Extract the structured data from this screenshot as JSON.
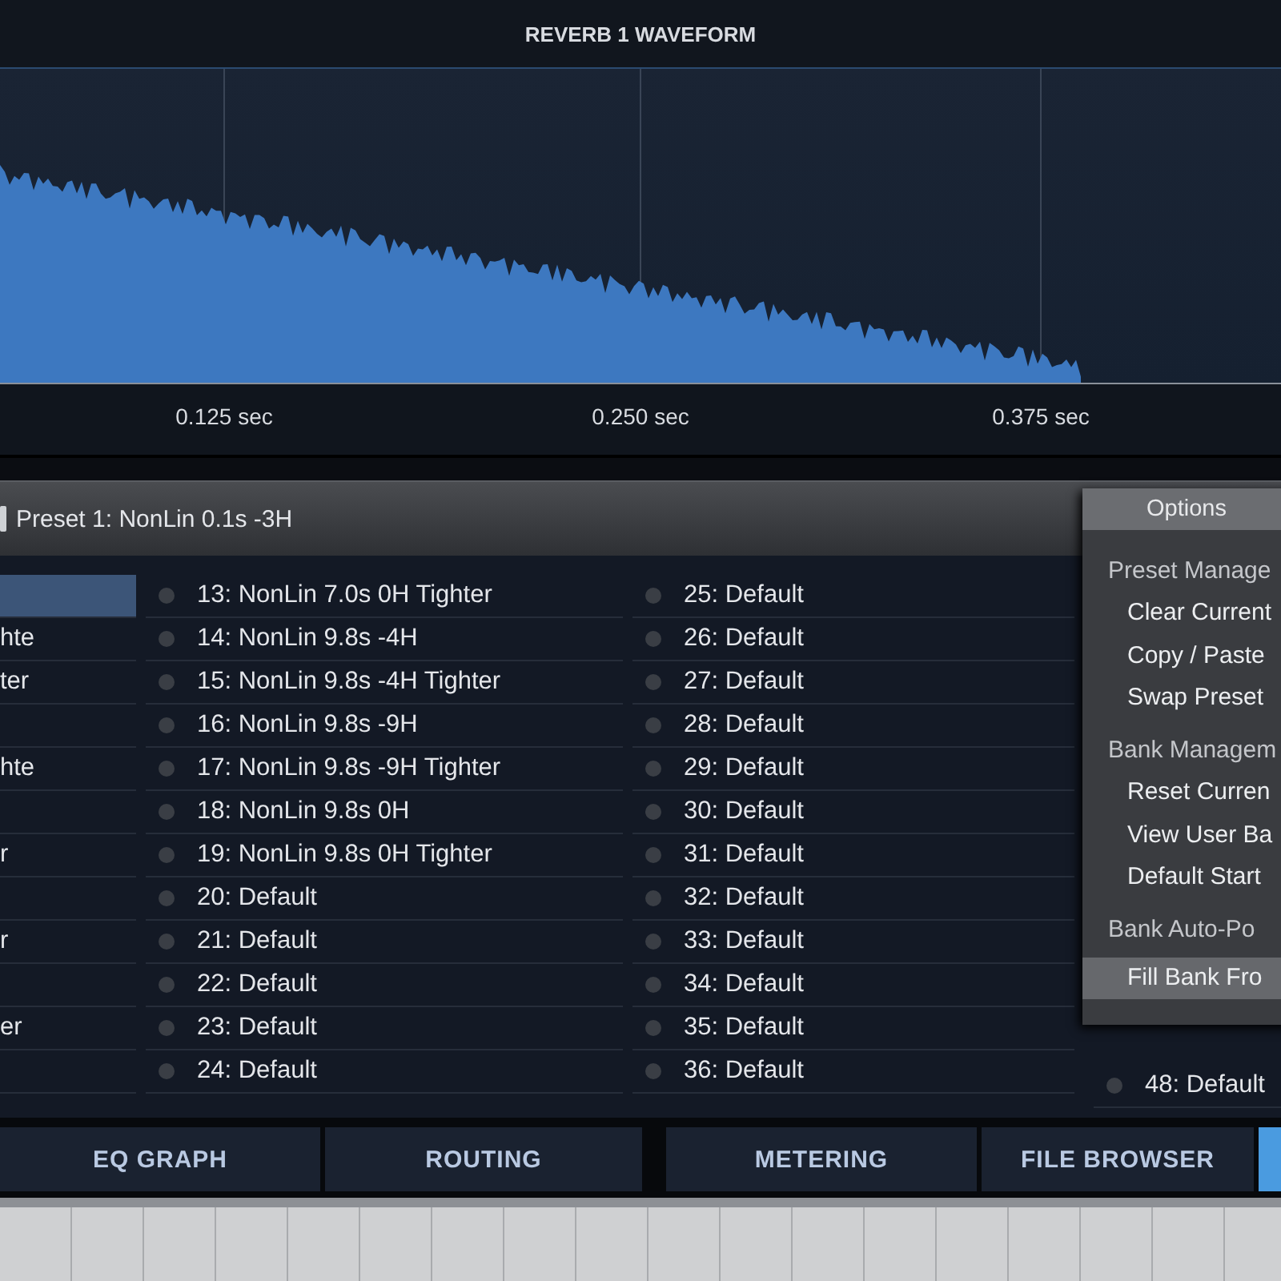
{
  "waveform": {
    "title": "REVERB 1 WAVEFORM",
    "tick_labels": [
      "0.125 sec",
      "0.250 sec",
      "0.375 sec"
    ]
  },
  "preset_bar": {
    "label": "Preset 1: NonLin 0.1s -3H"
  },
  "preset_columns": [
    {
      "kind": "cut",
      "items": [
        {
          "selected": true
        },
        {
          "label": "hte",
          "selected": false
        },
        {
          "label": "ter",
          "selected": false
        },
        {
          "selected": false
        },
        {
          "label": "hte",
          "selected": false
        },
        {
          "selected": false
        },
        {
          "label": "r",
          "selected": false
        },
        {
          "selected": false
        },
        {
          "label": "r",
          "selected": false
        },
        {
          "selected": false
        },
        {
          "label": "er",
          "selected": false
        },
        {
          "selected": false
        }
      ]
    },
    {
      "kind": "full",
      "items": [
        {
          "label": "13: NonLin 7.0s 0H Tighter",
          "selected": false
        },
        {
          "label": "14: NonLin 9.8s -4H",
          "selected": false
        },
        {
          "label": "15: NonLin 9.8s -4H Tighter",
          "selected": false
        },
        {
          "label": "16: NonLin 9.8s -9H",
          "selected": false
        },
        {
          "label": "17: NonLin 9.8s -9H Tighter",
          "selected": false
        },
        {
          "label": "18: NonLin 9.8s 0H",
          "selected": false
        },
        {
          "label": "19: NonLin 9.8s 0H Tighter",
          "selected": false
        },
        {
          "label": "20: Default",
          "selected": false
        },
        {
          "label": "21: Default",
          "selected": false
        },
        {
          "label": "22: Default",
          "selected": false
        },
        {
          "label": "23: Default",
          "selected": false
        },
        {
          "label": "24: Default",
          "selected": false
        }
      ]
    },
    {
      "kind": "full",
      "items": [
        {
          "label": "25: Default",
          "selected": false
        },
        {
          "label": "26: Default",
          "selected": false
        },
        {
          "label": "27: Default",
          "selected": false
        },
        {
          "label": "28: Default",
          "selected": false
        },
        {
          "label": "29: Default",
          "selected": false
        },
        {
          "label": "30: Default",
          "selected": false
        },
        {
          "label": "31: Default",
          "selected": false
        },
        {
          "label": "32: Default",
          "selected": false
        },
        {
          "label": "33: Default",
          "selected": false
        },
        {
          "label": "34: Default",
          "selected": false
        },
        {
          "label": "35: Default",
          "selected": false
        },
        {
          "label": "36: Default",
          "selected": false
        }
      ]
    },
    {
      "kind": "full",
      "items": [
        {
          "label": "48: Default",
          "selected": false
        }
      ]
    }
  ],
  "options_menu": {
    "title": "Options",
    "items": [
      {
        "kind": "header",
        "label": "Preset Manage",
        "selected": false
      },
      {
        "kind": "item",
        "label": "Clear Current",
        "selected": false
      },
      {
        "kind": "item",
        "label": "Copy / Paste",
        "selected": false
      },
      {
        "kind": "item",
        "label": "Swap Preset",
        "selected": false
      },
      {
        "kind": "header",
        "label": "Bank Managem",
        "selected": false
      },
      {
        "kind": "item",
        "label": "Reset Curren",
        "selected": false
      },
      {
        "kind": "item",
        "label": "View User Ba",
        "selected": false
      },
      {
        "kind": "item",
        "label": "Default Start",
        "selected": false
      },
      {
        "kind": "header",
        "label": "Bank Auto-Po",
        "selected": false
      },
      {
        "kind": "item",
        "label": "Fill Bank Fro",
        "selected": true
      }
    ]
  },
  "tabs": [
    {
      "label": "EQ GRAPH",
      "selected": false
    },
    {
      "label": "ROUTING",
      "selected": false
    },
    {
      "label": "METERING",
      "selected": false
    },
    {
      "label": "FILE BROWSER",
      "selected": false
    },
    {
      "selected": true
    }
  ]
}
